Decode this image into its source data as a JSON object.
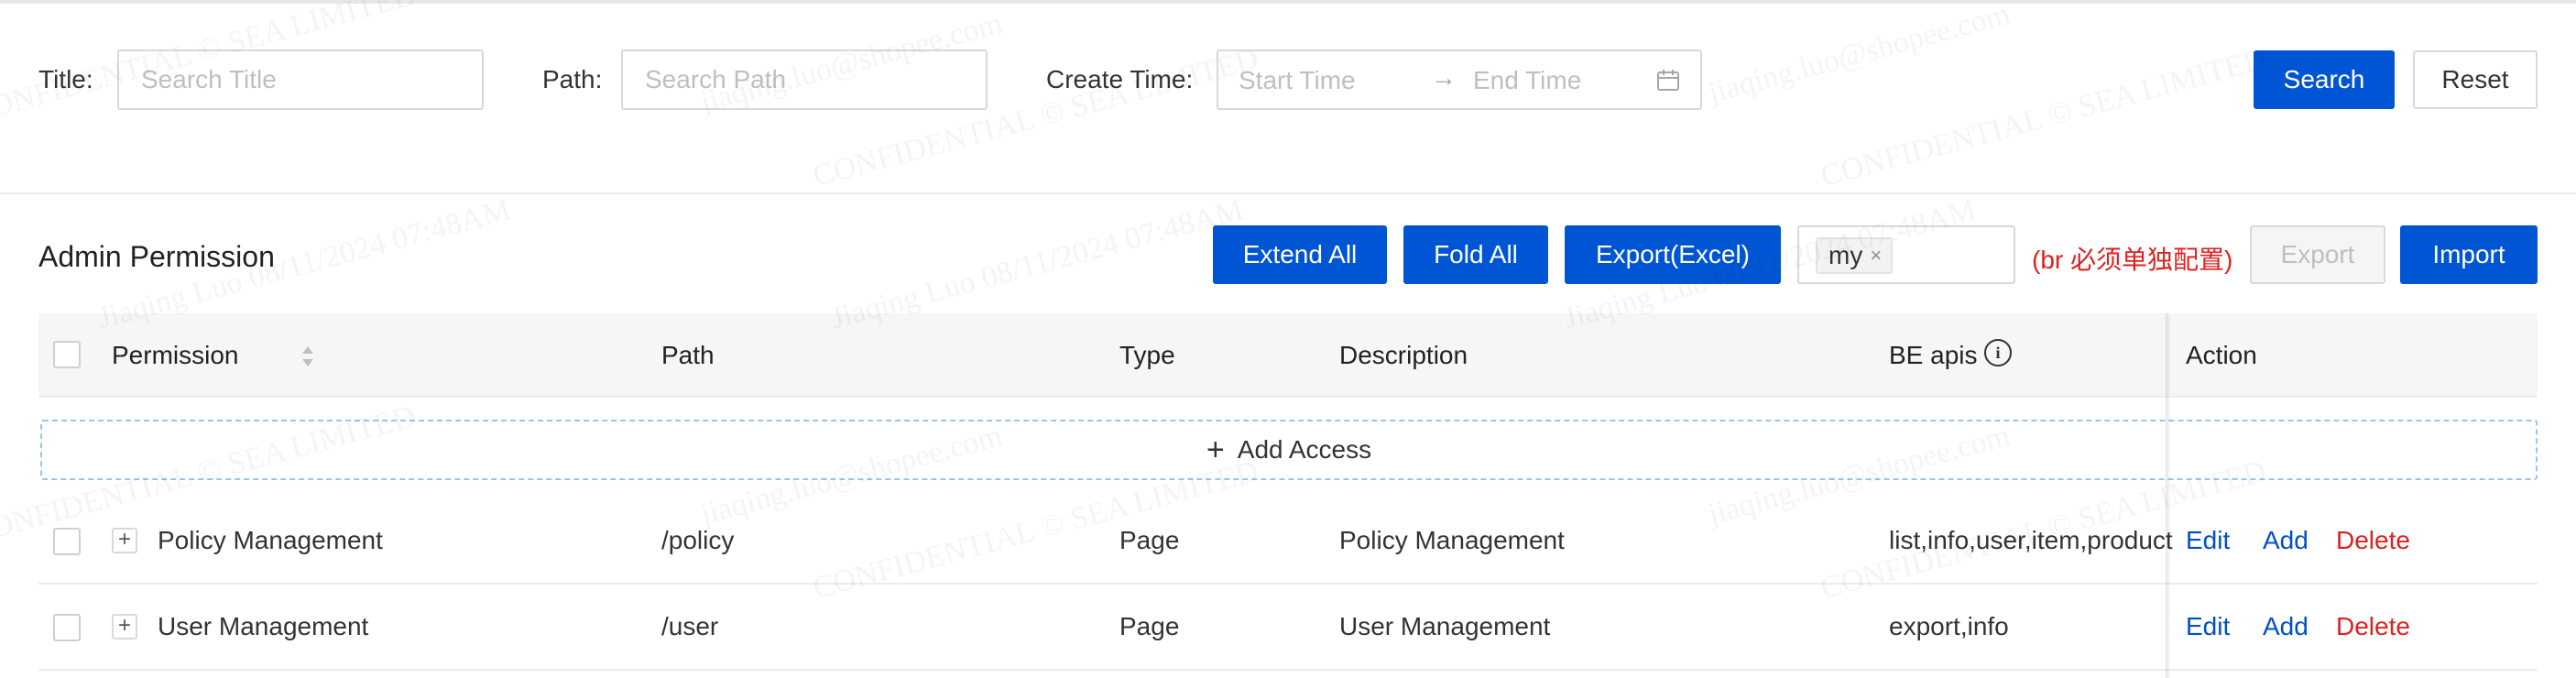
{
  "filters": {
    "title_label": "Title:",
    "title_placeholder": "Search Title",
    "path_label": "Path:",
    "path_placeholder": "Search Path",
    "create_time_label": "Create Time:",
    "start_placeholder": "Start Time",
    "end_placeholder": "End Time",
    "arrow": "→",
    "search_button": "Search",
    "reset_button": "Reset"
  },
  "card": {
    "title": "Admin Permission",
    "extend_all": "Extend All",
    "fold_all": "Fold All",
    "export_excel": "Export(Excel)",
    "tag_value": "my",
    "tag_close": "×",
    "hint": "(br 必须单独配置)",
    "export": "Export",
    "import": "Import"
  },
  "table": {
    "columns": {
      "permission": "Permission",
      "path": "Path",
      "type": "Type",
      "description": "Description",
      "be_apis": "BE apis",
      "action": "Action"
    },
    "add_access": "Add Access",
    "rows": [
      {
        "permission": "Policy Management",
        "path": "/policy",
        "type": "Page",
        "description": "Policy Management",
        "be_apis": "list,info,user,item,product",
        "edit": "Edit",
        "add": "Add",
        "delete": "Delete"
      },
      {
        "permission": "User Management",
        "path": "/user",
        "type": "Page",
        "description": "User Management",
        "be_apis": "export,info",
        "edit": "Edit",
        "add": "Add",
        "delete": "Delete"
      }
    ]
  },
  "watermark": {
    "email": "jiaqing.luo@shopee.com",
    "company": "CONFIDENTIAL © SEA LIMITED",
    "signature": "Jiaqing Luo 08/11/2024 07:48AM"
  },
  "colors": {
    "primary": "#0055d4",
    "link": "#0050c8",
    "danger": "#e02020",
    "header_bg": "#f6f6f6"
  },
  "icons": {
    "calendar": "calendar-icon",
    "sort": "sort-icon",
    "info": "info-icon",
    "plus": "plus-icon",
    "expand": "expand-icon",
    "tag_close": "close-icon"
  }
}
